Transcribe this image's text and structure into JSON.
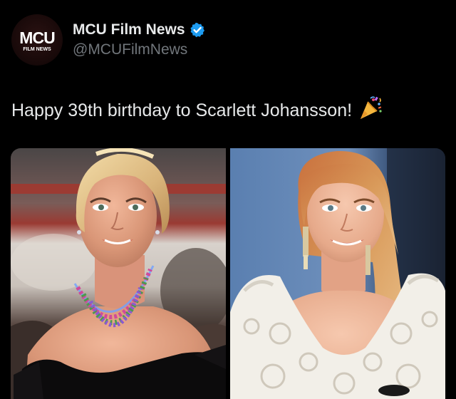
{
  "account": {
    "avatar_logo_text": "MCU",
    "avatar_logo_subtext": "FILM NEWS",
    "display_name": "MCU Film News",
    "handle": "@MCUFilmNews",
    "verified": true
  },
  "tweet": {
    "text": "Happy 39th birthday to Scarlett Johansson!",
    "emoji": "party-popper-icon"
  },
  "media": {
    "photos": [
      {
        "name": "photo-left",
        "subject": "portrait-black-dress-necklace"
      },
      {
        "name": "photo-right",
        "subject": "portrait-white-lace-dress"
      }
    ]
  },
  "colors": {
    "background": "#000000",
    "text_primary": "#e7e9ea",
    "text_secondary": "#71767b",
    "verified_blue": "#1d9bf0"
  }
}
